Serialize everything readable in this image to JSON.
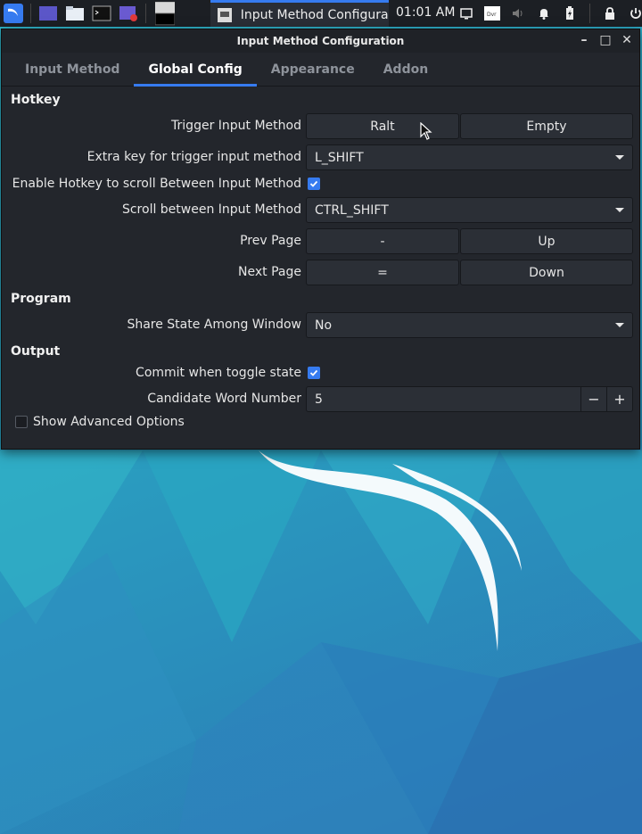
{
  "taskbar": {
    "task_title": "Input Method Configurat...",
    "clock": "01:01 AM",
    "left_icons": [
      "kali-menu-icon",
      "desktop-icon",
      "file-manager-icon",
      "terminal-icon",
      "screen-recorder-icon",
      "workspace-icon"
    ],
    "right_icons": [
      "display-icon",
      "keyboard-layout-icon",
      "volume-icon",
      "notification-bell-icon",
      "battery-icon",
      "lock-icon",
      "power-icon"
    ]
  },
  "window": {
    "title": "Input Method Configuration",
    "buttons": {
      "minimize": "–",
      "maximize": "□",
      "close": "✕"
    }
  },
  "tabs": [
    {
      "label": "Input Method",
      "active": false
    },
    {
      "label": "Global Config",
      "active": true
    },
    {
      "label": "Appearance",
      "active": false
    },
    {
      "label": "Addon",
      "active": false
    }
  ],
  "hotkey": {
    "section": "Hotkey",
    "trigger_label": "Trigger Input Method",
    "trigger_key1": "Ralt",
    "trigger_key2": "Empty",
    "extra_key_label": "Extra key for trigger input method",
    "extra_key_value": "L_SHIFT",
    "enable_scroll_label": "Enable Hotkey to scroll Between Input Method",
    "enable_scroll_checked": true,
    "scroll_label": "Scroll between Input Method",
    "scroll_value": "CTRL_SHIFT",
    "prev_page_label": "Prev Page",
    "prev_page_key1": "-",
    "prev_page_key2": "Up",
    "next_page_label": "Next Page",
    "next_page_key1": "=",
    "next_page_key2": "Down"
  },
  "program": {
    "section": "Program",
    "share_state_label": "Share State Among Window",
    "share_state_value": "No"
  },
  "output": {
    "section": "Output",
    "commit_label": "Commit when toggle state",
    "commit_checked": true,
    "candidate_label": "Candidate Word Number",
    "candidate_value": "5",
    "minus": "−",
    "plus": "+"
  },
  "advanced": {
    "label": "Show Advanced Options",
    "checked": false
  },
  "colors": {
    "accent": "#367bf0",
    "window_bg": "#23262c",
    "taskbar_bg": "#1c1f24"
  }
}
